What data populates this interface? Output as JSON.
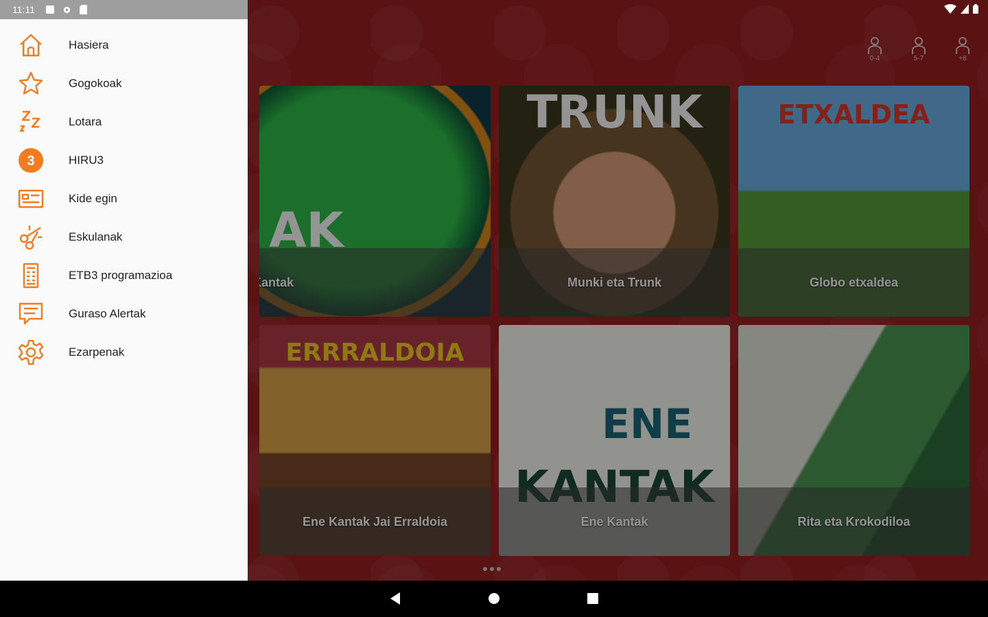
{
  "status_bar": {
    "time": "11:11"
  },
  "drawer": {
    "items": [
      {
        "label": "Hasiera",
        "icon": "home-icon"
      },
      {
        "label": "Gogokoak",
        "icon": "star-icon"
      },
      {
        "label": "Lotara",
        "icon": "sleep-icon"
      },
      {
        "label": "HIRU3",
        "icon": "hiru3-icon",
        "badge": "3"
      },
      {
        "label": "Kide egin",
        "icon": "member-card-icon"
      },
      {
        "label": "Eskulanak",
        "icon": "scissors-icon"
      },
      {
        "label": "ETB3 programazioa",
        "icon": "schedule-icon"
      },
      {
        "label": "Guraso Alertak",
        "icon": "chat-alert-icon"
      },
      {
        "label": "Ezarpenak",
        "icon": "gear-icon"
      }
    ]
  },
  "age_filters": [
    {
      "label": "0-4"
    },
    {
      "label": "5-7"
    },
    {
      "label": "+8"
    }
  ],
  "cards": [
    {
      "caption": "Kantak",
      "art_text": "AK"
    },
    {
      "caption": "Munki eta Trunk",
      "art_text": "TRUNK"
    },
    {
      "caption": "Globo etxaldea",
      "art_text": "ETXALDEA"
    },
    {
      "caption": "Ene Kantak Jai Erraldoia",
      "art_text": "ERRRALDOIA"
    },
    {
      "caption": "Ene Kantak",
      "art_text_1": "ENE",
      "art_text_2": "KANTAK"
    },
    {
      "caption": "Rita eta Krokodiloa"
    }
  ],
  "colors": {
    "accent": "#f47b1f",
    "background": "#9c1f22",
    "drawer": "#fafafa"
  }
}
